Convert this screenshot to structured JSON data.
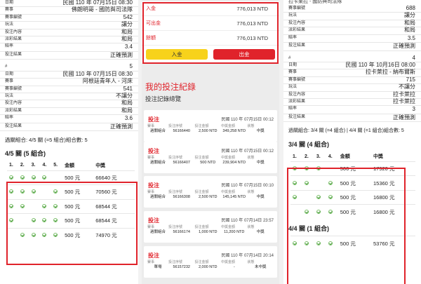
{
  "left": {
    "ticket1": {
      "rows": [
        {
          "k": "日期",
          "v": "民國 110 年 07月15日 08:30"
        },
        {
          "k": "賽事",
          "v": "佛朗明哥 - 國防與司法隊"
        },
        {
          "k": "賽事編號",
          "v": "542"
        },
        {
          "k": "玩法",
          "v": "讓分"
        },
        {
          "k": "投注內容",
          "v": "和局"
        },
        {
          "k": "派彩結果",
          "v": "和局"
        },
        {
          "k": "賠率",
          "v": "3.4"
        },
        {
          "k": "投注結果",
          "v": "正確預測"
        }
      ]
    },
    "ticket2": {
      "rows": [
        {
          "k": "#",
          "v": "5"
        },
        {
          "k": "日期",
          "v": "民國 110 年 07月15日 08:30"
        },
        {
          "k": "賽事",
          "v": "阿根廷青年人 - 河床"
        },
        {
          "k": "賽事編號",
          "v": "541"
        },
        {
          "k": "玩法",
          "v": "不讓分"
        },
        {
          "k": "投注內容",
          "v": "和局"
        },
        {
          "k": "派彩結果",
          "v": "和局"
        },
        {
          "k": "賠率",
          "v": "3.6"
        },
        {
          "k": "投注結果",
          "v": "正確預測"
        }
      ]
    },
    "combo_line": "過關組合: 4/5 關 (=5 組合)組合數: 5",
    "section": "4/5 關 (5 組合)",
    "table": {
      "headers": [
        "1.",
        "2.",
        "3.",
        "4.",
        "5.",
        "金額",
        "中獎"
      ],
      "rows": [
        {
          "checks": [
            true,
            true,
            true,
            true,
            false
          ],
          "amount": "500 元",
          "prize": "66640 元"
        },
        {
          "checks": [
            true,
            true,
            true,
            false,
            true
          ],
          "amount": "500 元",
          "prize": "70560 元"
        },
        {
          "checks": [
            true,
            true,
            false,
            true,
            true
          ],
          "amount": "500 元",
          "prize": "68544 元"
        },
        {
          "checks": [
            true,
            false,
            true,
            true,
            true
          ],
          "amount": "500 元",
          "prize": "68544 元"
        },
        {
          "checks": [
            false,
            true,
            true,
            true,
            true
          ],
          "amount": "500 元",
          "prize": "74970 元"
        }
      ]
    }
  },
  "middle": {
    "balances": [
      {
        "k": "入金",
        "v": "776,013 NTD"
      },
      {
        "k": "可出金",
        "v": "776,013 NTD"
      },
      {
        "k": "餘額",
        "v": "776,013 NTD"
      }
    ],
    "deposit_btn": "入金",
    "withdraw_btn": "出金",
    "title": "我的投注紀錄",
    "subtitle": "投注記錄總覽",
    "col_labels": [
      "賽事",
      "投注序號",
      "投注金額",
      "中獎金額",
      "狀態"
    ],
    "bets": [
      {
        "tag": "投注",
        "date": "民國 110 年 07月15日 00:12",
        "type": "過關組合",
        "serial": "56166440",
        "amount": "2,500 NTD",
        "prize": "349,258 NTD",
        "status": "中獎"
      },
      {
        "tag": "投注",
        "date": "民國 110 年 07月15日 00:12",
        "type": "過關組合",
        "serial": "56166407",
        "amount": "500 NTD",
        "prize": "239,904 NTD",
        "status": "中獎"
      },
      {
        "tag": "投注",
        "date": "民國 110 年 07月15日 00:10",
        "type": "過關組合",
        "serial": "56166308",
        "amount": "2,500 NTD",
        "prize": "145,145 NTD",
        "status": "中獎"
      },
      {
        "tag": "投注",
        "date": "民國 110 年 07月14日 23:57",
        "type": "過關組合",
        "serial": "56166174",
        "amount": "1,000 NTD",
        "prize": "11,200 NTD",
        "status": "中獎"
      },
      {
        "tag": "投注",
        "date": "民國 110 年 07月14日 20:14",
        "type": "單場",
        "serial": "56157232",
        "amount": "2,000 NTD",
        "prize": "-",
        "status": "未中獎"
      }
    ]
  },
  "right": {
    "top_cut": "拉卡莱拉 - 國防與司法隊",
    "ticket1": {
      "rows": [
        {
          "k": "賽事編號",
          "v": "688"
        },
        {
          "k": "玩法",
          "v": "讓分"
        },
        {
          "k": "投注內容",
          "v": "和局"
        },
        {
          "k": "派彩結果",
          "v": "和局"
        },
        {
          "k": "賠率",
          "v": "3.5"
        },
        {
          "k": "投注結果",
          "v": "正確預測"
        }
      ]
    },
    "ticket2": {
      "rows": [
        {
          "k": "#",
          "v": "4"
        },
        {
          "k": "日期",
          "v": "民國 110 年 10月16日 08:00"
        },
        {
          "k": "賽事",
          "v": "拉卡萊拉 - 納布爾斯"
        },
        {
          "k": "賽事編號",
          "v": "715"
        },
        {
          "k": "玩法",
          "v": "不讓分"
        },
        {
          "k": "投注內容",
          "v": "拉卡萊拉"
        },
        {
          "k": "派彩結果",
          "v": "拉卡萊拉"
        },
        {
          "k": "賠率",
          "v": "3"
        },
        {
          "k": "投注結果",
          "v": "正確預測"
        }
      ]
    },
    "combo_line": "過關組合: 3/4 關 (=4 組合) | 4/4 關 (=1 組合)組合數: 5",
    "section1": "3/4 關 (4 組合)",
    "table1": {
      "headers": [
        "1.",
        "2.",
        "3.",
        "4.",
        "金額",
        "中獎"
      ],
      "rows": [
        {
          "checks": [
            true,
            true,
            true,
            false
          ],
          "amount": "500 元",
          "prize": "17920 元"
        },
        {
          "checks": [
            true,
            true,
            false,
            true
          ],
          "amount": "500 元",
          "prize": "15360 元"
        },
        {
          "checks": [
            true,
            false,
            true,
            true
          ],
          "amount": "500 元",
          "prize": "16800 元"
        },
        {
          "checks": [
            false,
            true,
            true,
            true
          ],
          "amount": "500 元",
          "prize": "16800 元"
        }
      ]
    },
    "section2": "4/4 關 (1 組合)",
    "table2": {
      "rows": [
        {
          "checks": [
            true,
            true,
            true,
            true
          ],
          "amount": "500 元",
          "prize": "53760 元"
        }
      ]
    }
  }
}
